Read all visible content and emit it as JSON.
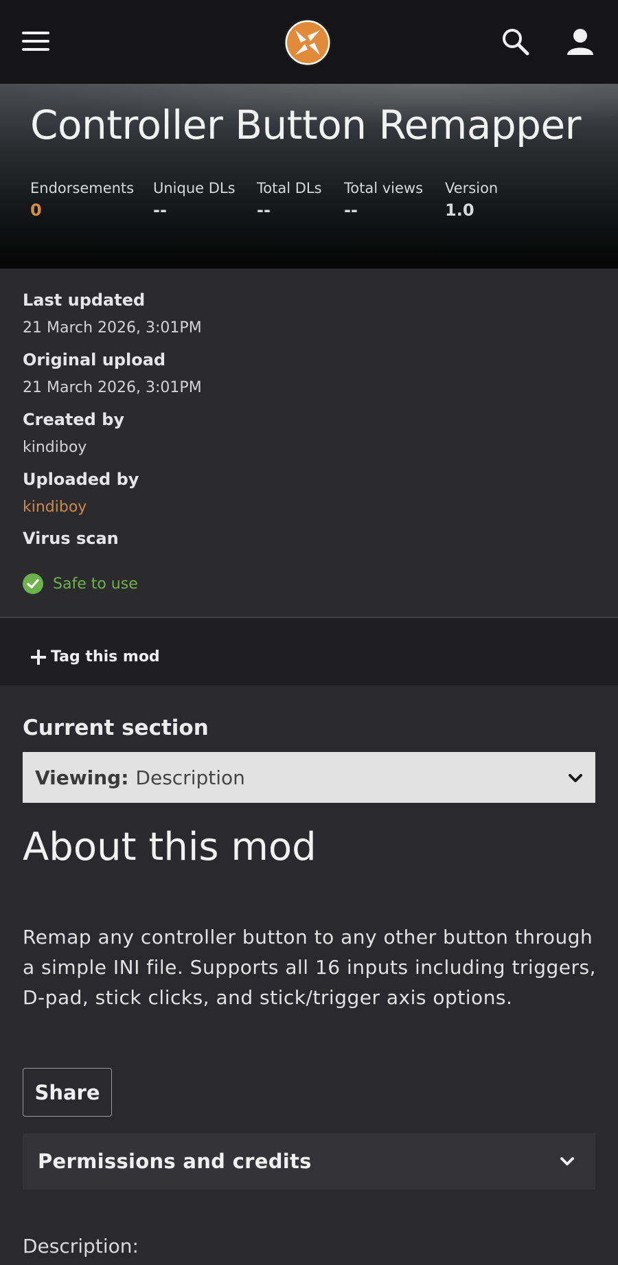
{
  "header": {
    "menu_icon": "hamburger-menu-icon",
    "logo_icon": "nexus-logo-icon",
    "search_icon": "search-icon",
    "user_icon": "user-icon"
  },
  "hero": {
    "title": "Controller Button Remapper",
    "stats": [
      {
        "label": "Endorsements",
        "value": "0"
      },
      {
        "label": "Unique DLs",
        "value": "--"
      },
      {
        "label": "Total DLs",
        "value": "--"
      },
      {
        "label": "Total views",
        "value": "--"
      },
      {
        "label": "Version",
        "value": "1.0"
      }
    ]
  },
  "meta": {
    "last_updated_label": "Last updated",
    "last_updated_value": "21 March 2026, 3:01PM",
    "original_upload_label": "Original upload",
    "original_upload_value": "21 March 2026, 3:01PM",
    "created_by_label": "Created by",
    "created_by_value": "kindiboy",
    "uploaded_by_label": "Uploaded by",
    "uploaded_by_value": "kindiboy",
    "virus_scan_label": "Virus scan",
    "virus_scan_value": "Safe to use"
  },
  "tag": {
    "label": "Tag this mod"
  },
  "content": {
    "current_section_label": "Current section",
    "viewing_key": "Viewing:",
    "viewing_value": "Description",
    "about_title": "About this mod",
    "about_text": "Remap any controller button to any other button through a simple INI file. Supports all 16 inputs including triggers, D-pad, stick clicks, and stick/trigger axis options.",
    "share_label": "Share",
    "permissions_label": "Permissions and credits",
    "description_label": "Description:"
  },
  "colors": {
    "accent_orange": "#d98f3e",
    "link_orange": "#c98a4c",
    "safe_green": "#6db24b",
    "topbar_bg": "#151517"
  }
}
